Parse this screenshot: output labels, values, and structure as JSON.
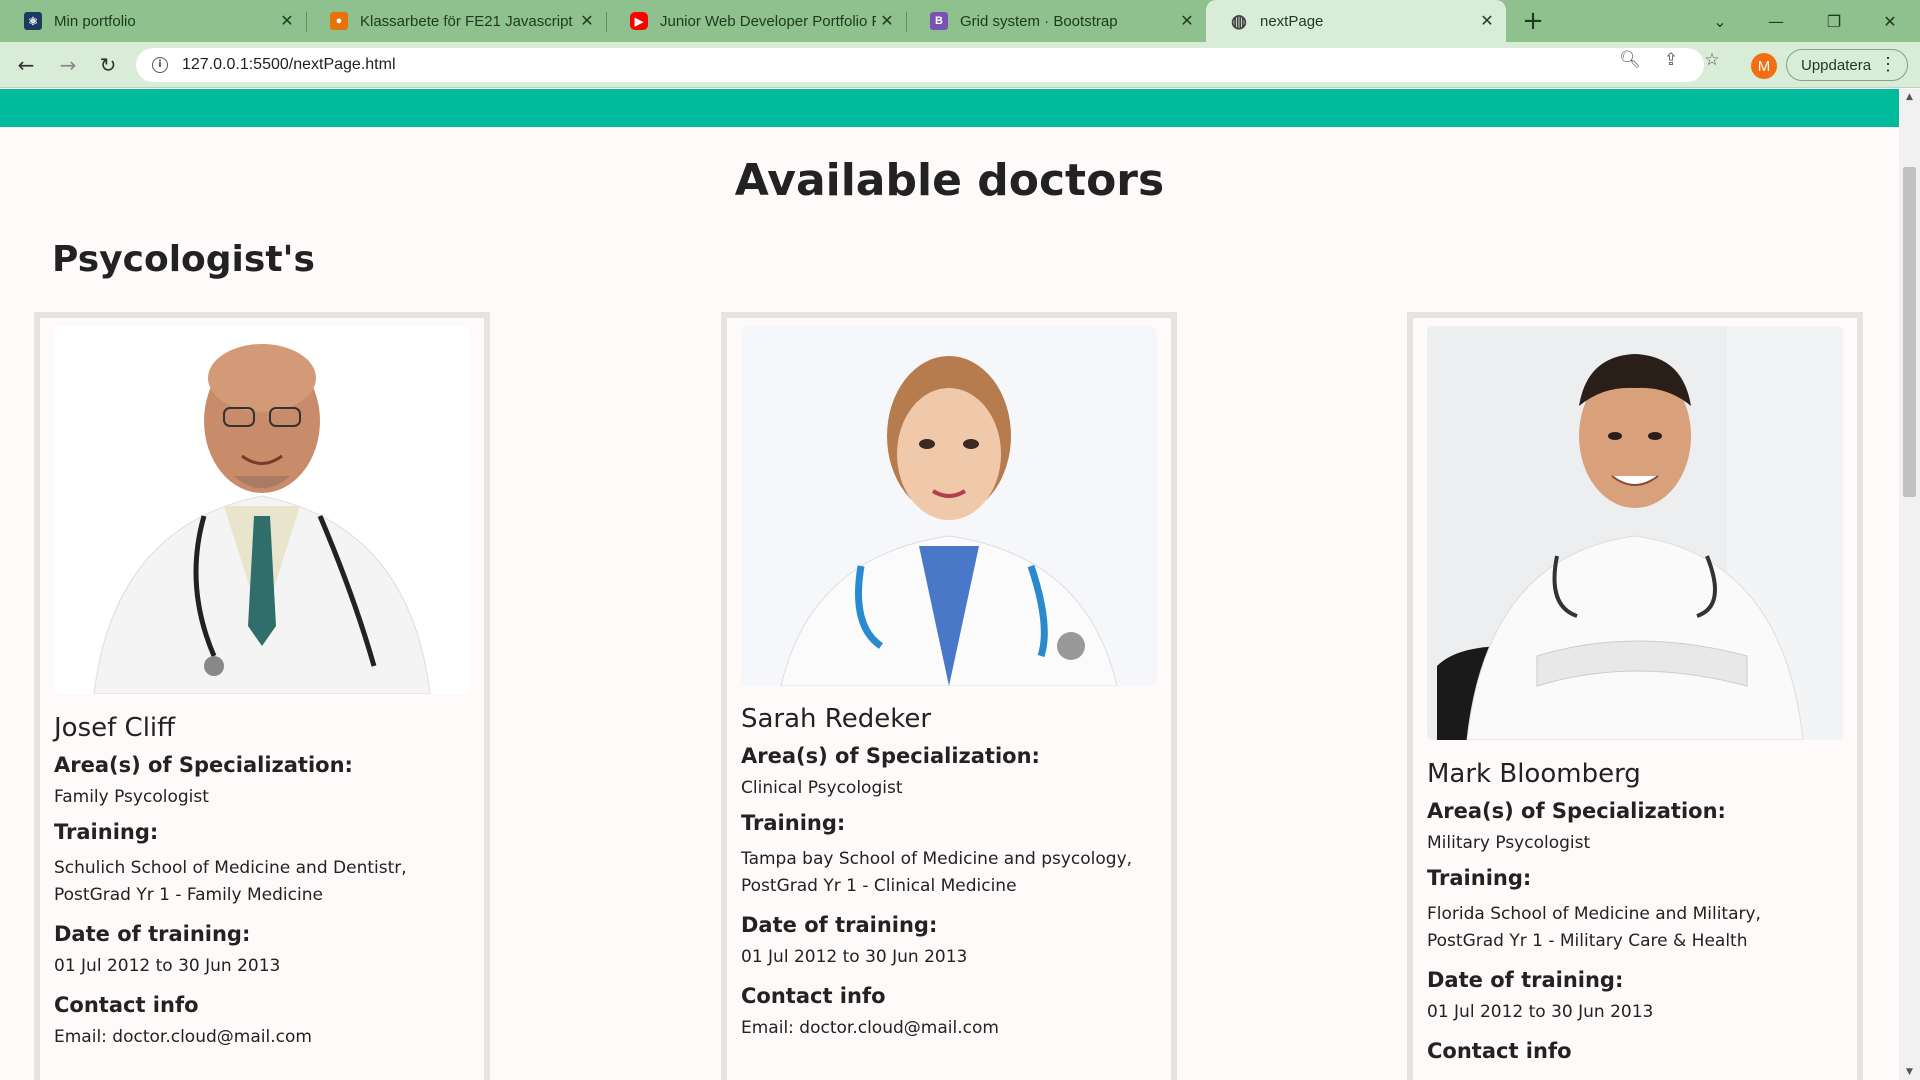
{
  "browser": {
    "tabs": [
      {
        "title": "Min portfolio",
        "icon": "react-icon",
        "color": "#1f3a5f"
      },
      {
        "title": "Klassarbete för FE21 Javascript 2",
        "icon": "user-icon",
        "color": "#e8710a"
      },
      {
        "title": "Junior Web Developer Portfolio P",
        "icon": "youtube-icon",
        "color": "#ff0000"
      },
      {
        "title": "Grid system · Bootstrap",
        "icon": "bootstrap-icon",
        "color": "#7952b3"
      },
      {
        "title": "nextPage",
        "icon": "globe-icon",
        "color": "#444444"
      }
    ],
    "active_tab_index": 4,
    "url": "127.0.0.1:5500/nextPage.html",
    "avatar_letter": "M",
    "update_label": "Uppdatera",
    "colors": {
      "tabbar": "#8ec18e",
      "toolbar": "#d8ecd8",
      "avatar": "#f26e11"
    }
  },
  "page": {
    "header_color": "#00bb9c",
    "title": "Available doctors",
    "section_title": "Psycologist's",
    "doctors": [
      {
        "name": "Josef Cliff",
        "spec_label": "Area(s) of Specialization:",
        "spec": "Family Psycologist",
        "training_label": "Training:",
        "training_line1": "Schulich School of Medicine and Dentistr,",
        "training_line2": "PostGrad Yr 1 - Family Medicine",
        "date_label": "Date of training:",
        "date": "01 Jul 2012 to 30 Jun 2013",
        "contact_label": "Contact info",
        "email": "Email: doctor.cloud@mail.com"
      },
      {
        "name": "Sarah Redeker",
        "spec_label": "Area(s) of Specialization:",
        "spec": "Clinical Psycologist",
        "training_label": "Training:",
        "training_line1": "Tampa bay School of Medicine and psycology,",
        "training_line2": "PostGrad Yr 1 - Clinical Medicine",
        "date_label": "Date of training:",
        "date": "01 Jul 2012 to 30 Jun 2013",
        "contact_label": "Contact info",
        "email": "Email: doctor.cloud@mail.com"
      },
      {
        "name": "Mark Bloomberg",
        "spec_label": "Area(s) of Specialization:",
        "spec": "Military Psycologist",
        "training_label": "Training:",
        "training_line1": "Florida School of Medicine and Military,",
        "training_line2": "PostGrad Yr 1 - Military Care & Health",
        "date_label": "Date of training:",
        "date": "01 Jul 2012 to 30 Jun 2013",
        "contact_label": "Contact info",
        "email": ""
      }
    ]
  }
}
